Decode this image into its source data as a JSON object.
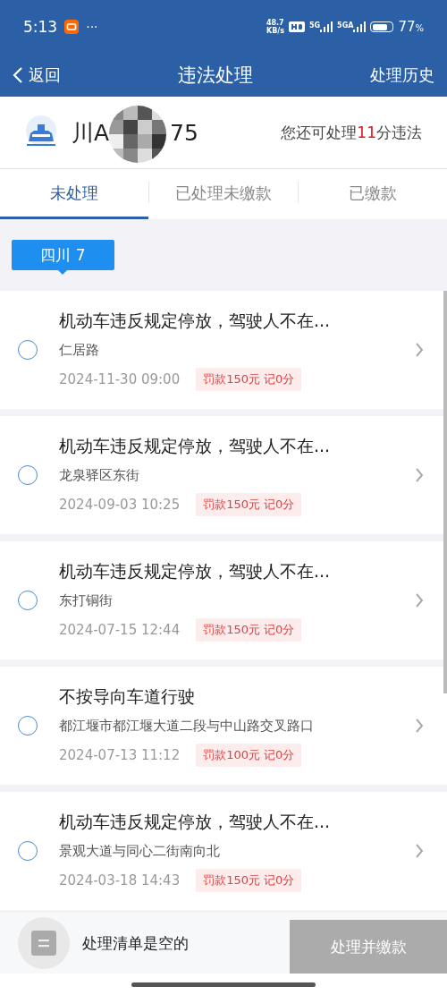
{
  "status_bar": {
    "time": "5:13",
    "more": "···",
    "net_speed_value": "48.7",
    "net_speed_unit": "KB/s",
    "net_5g": "5G",
    "net_5ga": "5GA",
    "battery": "77",
    "battery_unit": "%"
  },
  "nav": {
    "back": "返回",
    "title": "违法处理",
    "history": "处理历史"
  },
  "vehicle": {
    "plate_start": "川A",
    "plate_end": "75",
    "remaining_before": "您还可处理",
    "remaining_count": "11",
    "remaining_after": "分违法"
  },
  "tabs": [
    {
      "label": "未处理",
      "selected": true
    },
    {
      "label": "已处理未缴款",
      "selected": false
    },
    {
      "label": "已缴款",
      "selected": false
    }
  ],
  "region_chip": "四川 7",
  "violations": [
    {
      "title": "机动车违反规定停放，驾驶人不在...",
      "place": "仁居路",
      "time": "2024-11-30 09:00",
      "penalty": "罚款150元 记0分",
      "checked": false
    },
    {
      "title": "机动车违反规定停放，驾驶人不在...",
      "place": "龙泉驿区东街",
      "time": "2024-09-03 10:25",
      "penalty": "罚款150元 记0分",
      "checked": false
    },
    {
      "title": "机动车违反规定停放，驾驶人不在...",
      "place": "东打铜街",
      "time": "2024-07-15 12:44",
      "penalty": "罚款150元 记0分",
      "checked": false
    },
    {
      "title": "不按导向车道行驶",
      "place": "都江堰市都江堰大道二段与中山路交叉路口",
      "time": "2024-07-13 11:12",
      "penalty": "罚款100元 记0分",
      "checked": false
    },
    {
      "title": "机动车违反规定停放，驾驶人不在...",
      "place": "景观大道与同心二街南向北",
      "time": "2024-03-18 14:43",
      "penalty": "罚款150元 记0分",
      "checked": false
    }
  ],
  "footer": {
    "cart_text": "处理清单是空的",
    "pay_button": "处理并缴款",
    "pay_disabled": true
  }
}
